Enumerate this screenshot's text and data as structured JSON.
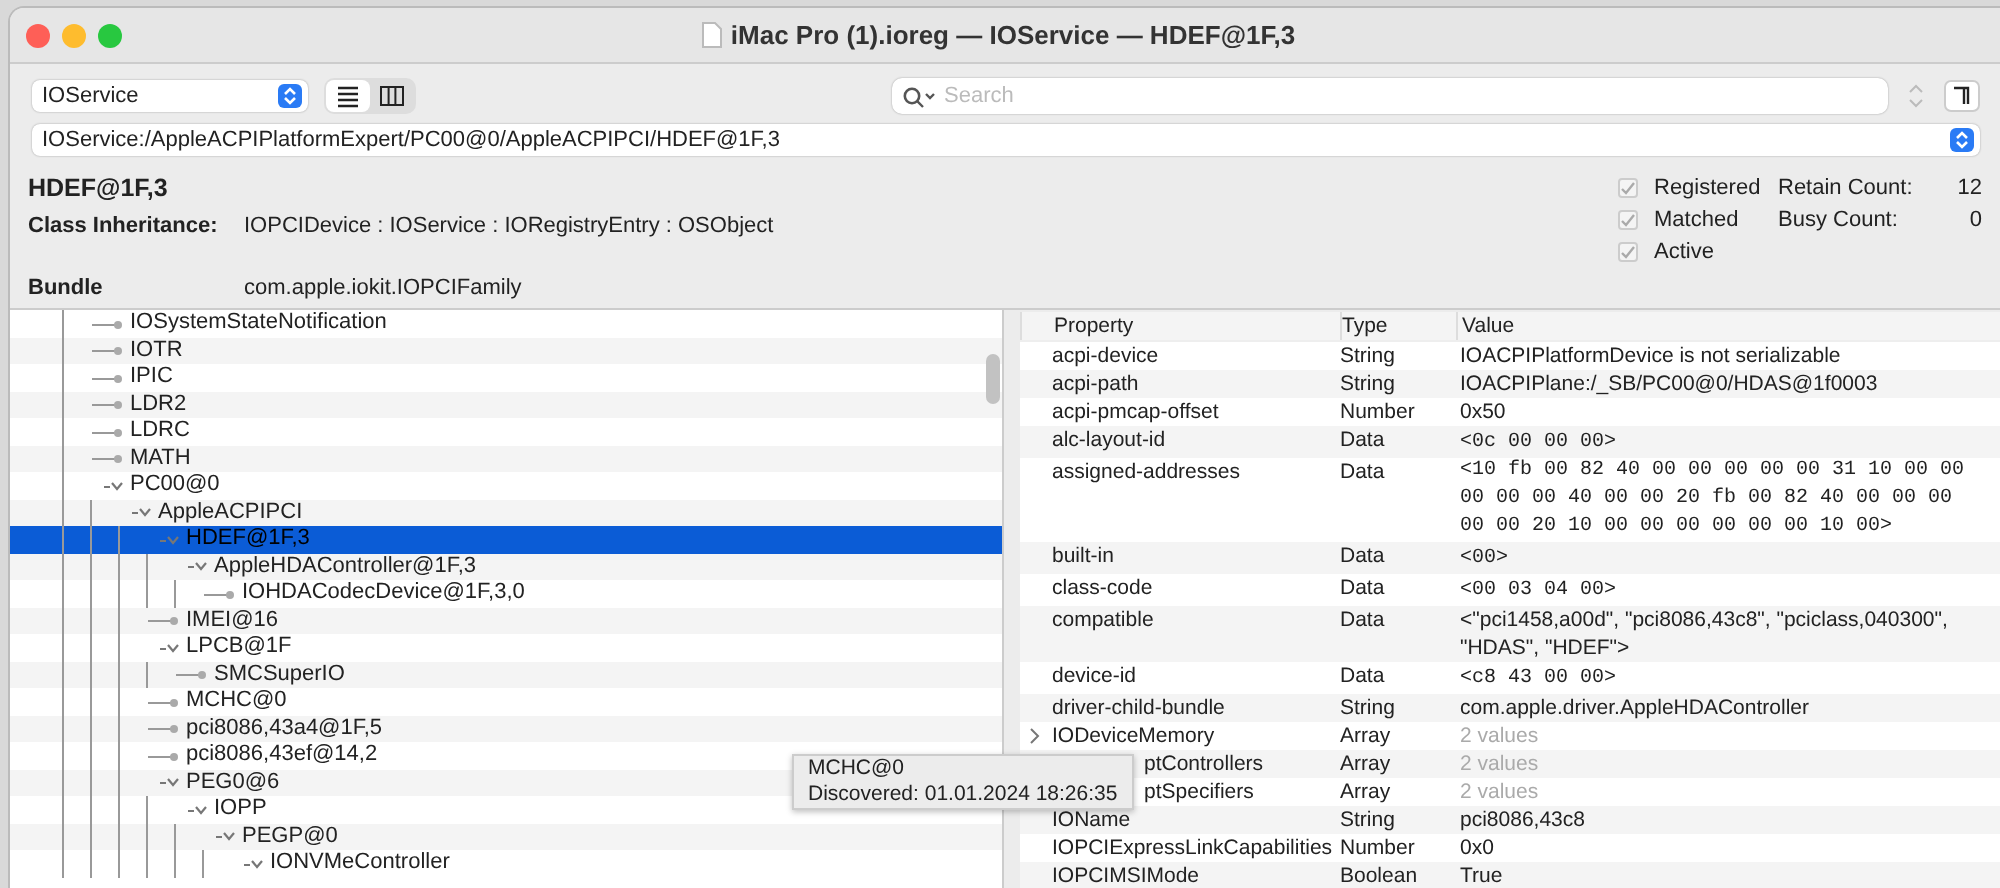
{
  "window": {
    "title": "iMac Pro (1).ioreg — IOService — HDEF@1F,3"
  },
  "toolbar": {
    "plane": "IOService",
    "views": [
      {
        "kind": "list",
        "selected": true
      },
      {
        "kind": "columns",
        "selected": false
      }
    ],
    "search": {
      "placeholder": "Search"
    }
  },
  "path": "IOService:/AppleACPIPlatformExpert/PC00@0/AppleACPIPCI/HDEF@1F,3",
  "info": {
    "name": "HDEF@1F,3",
    "inheritance_label": "Class Inheritance:",
    "inheritance": "IOPCIDevice : IOService : IORegistryEntry : OSObject",
    "bundle_label": "Bundle",
    "bundle": "com.apple.iokit.IOPCIFamily",
    "flags": [
      {
        "label": "Registered",
        "checked": true
      },
      {
        "label": "Matched",
        "checked": true
      },
      {
        "label": "Active",
        "checked": true
      }
    ],
    "counts": [
      {
        "label": "Retain Count:",
        "value": "12"
      },
      {
        "label": "Busy Count:",
        "value": "0"
      }
    ]
  },
  "tree": [
    {
      "label": "IOSystemStateNotification",
      "expanded": false,
      "selected": false
    },
    {
      "label": "IOTR",
      "expanded": false,
      "selected": false
    },
    {
      "label": "IPIC",
      "expanded": false,
      "selected": false
    },
    {
      "label": "LDR2",
      "expanded": false,
      "selected": false
    },
    {
      "label": "LDRC",
      "expanded": false,
      "selected": false
    },
    {
      "label": "MATH",
      "expanded": false,
      "selected": false
    },
    {
      "label": "PC00@0",
      "expanded": true,
      "selected": false,
      "children": [
        {
          "label": "AppleACPIPCI",
          "expanded": true,
          "selected": false,
          "children": [
            {
              "label": "HDEF@1F,3",
              "expanded": true,
              "selected": true,
              "children": [
                {
                  "label": "AppleHDAController@1F,3",
                  "expanded": true,
                  "selected": false,
                  "children": [
                    {
                      "label": "IOHDACodecDevice@1F,3,0",
                      "expanded": false,
                      "selected": false
                    }
                  ]
                }
              ]
            },
            {
              "label": "IMEI@16",
              "expanded": false,
              "selected": false
            },
            {
              "label": "LPCB@1F",
              "expanded": true,
              "selected": false,
              "children": [
                {
                  "label": "SMCSuperIO",
                  "expanded": false,
                  "selected": false
                }
              ]
            },
            {
              "label": "MCHC@0",
              "expanded": false,
              "selected": false
            },
            {
              "label": "pci8086,43a4@1F,5",
              "expanded": false,
              "selected": false
            },
            {
              "label": "pci8086,43ef@14,2",
              "expanded": false,
              "selected": false
            },
            {
              "label": "PEG0@6",
              "expanded": true,
              "selected": false,
              "children": [
                {
                  "label": "IOPP",
                  "expanded": true,
                  "selected": false,
                  "children": [
                    {
                      "label": "PEGP@0",
                      "expanded": true,
                      "selected": false,
                      "children": [
                        {
                          "label": "IONVMeController",
                          "expanded": true,
                          "selected": false
                        }
                      ]
                    }
                  ]
                }
              ]
            }
          ]
        }
      ]
    }
  ],
  "properties": {
    "columns": [
      "Property",
      "Type",
      "Value"
    ],
    "rows": [
      {
        "property": "acpi-device",
        "type": "String",
        "value": "IOACPIPlatformDevice is not serializable",
        "kind": "text",
        "expandable": false
      },
      {
        "property": "acpi-path",
        "type": "String",
        "value": "IOACPIPlane:/_SB/PC00@0/HDAS@1f0003",
        "kind": "text",
        "expandable": false
      },
      {
        "property": "acpi-pmcap-offset",
        "type": "Number",
        "value": "0x50",
        "kind": "text",
        "expandable": false
      },
      {
        "property": "alc-layout-id",
        "type": "Data",
        "value": "<0c 00 00 00>",
        "kind": "data",
        "expandable": false
      },
      {
        "property": "assigned-addresses",
        "type": "Data",
        "value": "<10 fb 00 82 40 00 00 00 00 00 31 10 00 00 00 00 00 40 00 00 20 fb 00 82 40 00 00 00 00 00 20 10 00 00 00 00 00 00 10 00>",
        "kind": "data",
        "expandable": false
      },
      {
        "property": "built-in",
        "type": "Data",
        "value": "<00>",
        "kind": "data",
        "expandable": false
      },
      {
        "property": "class-code",
        "type": "Data",
        "value": "<00 03 04 00>",
        "kind": "data",
        "expandable": false
      },
      {
        "property": "compatible",
        "type": "Data",
        "value": "<\"pci1458,a00d\", \"pci8086,43c8\", \"pciclass,040300\", \"HDAS\", \"HDEF\">",
        "kind": "text",
        "expandable": false
      },
      {
        "property": "device-id",
        "type": "Data",
        "value": "<c8 43 00 00>",
        "kind": "data",
        "expandable": false
      },
      {
        "property": "driver-child-bundle",
        "type": "String",
        "value": "com.apple.driver.AppleHDAController",
        "kind": "text",
        "expandable": false
      },
      {
        "property": "IODeviceMemory",
        "type": "Array",
        "value": "2 values",
        "kind": "summary",
        "expandable": true
      },
      {
        "property": "ptControllers",
        "type": "Array",
        "value": "2 values",
        "kind": "summary",
        "expandable": false,
        "covered": true
      },
      {
        "property": "ptSpecifiers",
        "type": "Array",
        "value": "2 values",
        "kind": "summary",
        "expandable": false,
        "covered": true
      },
      {
        "property": "IOName",
        "type": "String",
        "value": "pci8086,43c8",
        "kind": "text",
        "expandable": false
      },
      {
        "property": "IOPCIExpressLinkCapabilities",
        "type": "Number",
        "value": "0x0",
        "kind": "text",
        "expandable": false
      },
      {
        "property": "IOPCIMSIMode",
        "type": "Boolean",
        "value": "True",
        "kind": "text",
        "expandable": false
      }
    ]
  },
  "tooltip": {
    "title": "MCHC@0",
    "detail": "Discovered: 01.01.2024 18:26:35"
  }
}
